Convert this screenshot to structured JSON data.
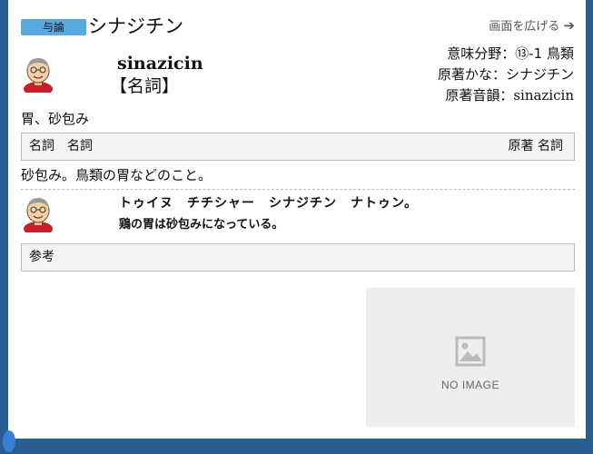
{
  "header": {
    "badge": "与論",
    "title": "シナジチン",
    "expand_label": "画面を広げる",
    "expand_icon": "arrow-right-icon"
  },
  "entry": {
    "romanization": "sinazicin",
    "part_of_speech": "【名詞】",
    "meta": [
      {
        "label": "意味分野：",
        "value": "⑬-1 鳥類"
      },
      {
        "label": "原著かな：",
        "value": "シナジチン"
      },
      {
        "label": "原著音韻：",
        "value": "sinazicin"
      }
    ],
    "gloss": "胃、砂包み",
    "pos_box": {
      "left": "名詞　名詞",
      "right": "原著 名詞"
    },
    "definition": "砂包み。鳥類の胃などのこと。"
  },
  "example": {
    "line1": "トゥイヌ　チチシャー　シナジチン　ナトゥン。",
    "line2": "鶏の胃は砂包みになっている。"
  },
  "reference": {
    "label": "参考"
  },
  "image": {
    "placeholder": "NO IMAGE",
    "icon": "image-placeholder-icon"
  },
  "colors": {
    "badge": "#5aa8e0",
    "frame": "#2a5d91"
  }
}
